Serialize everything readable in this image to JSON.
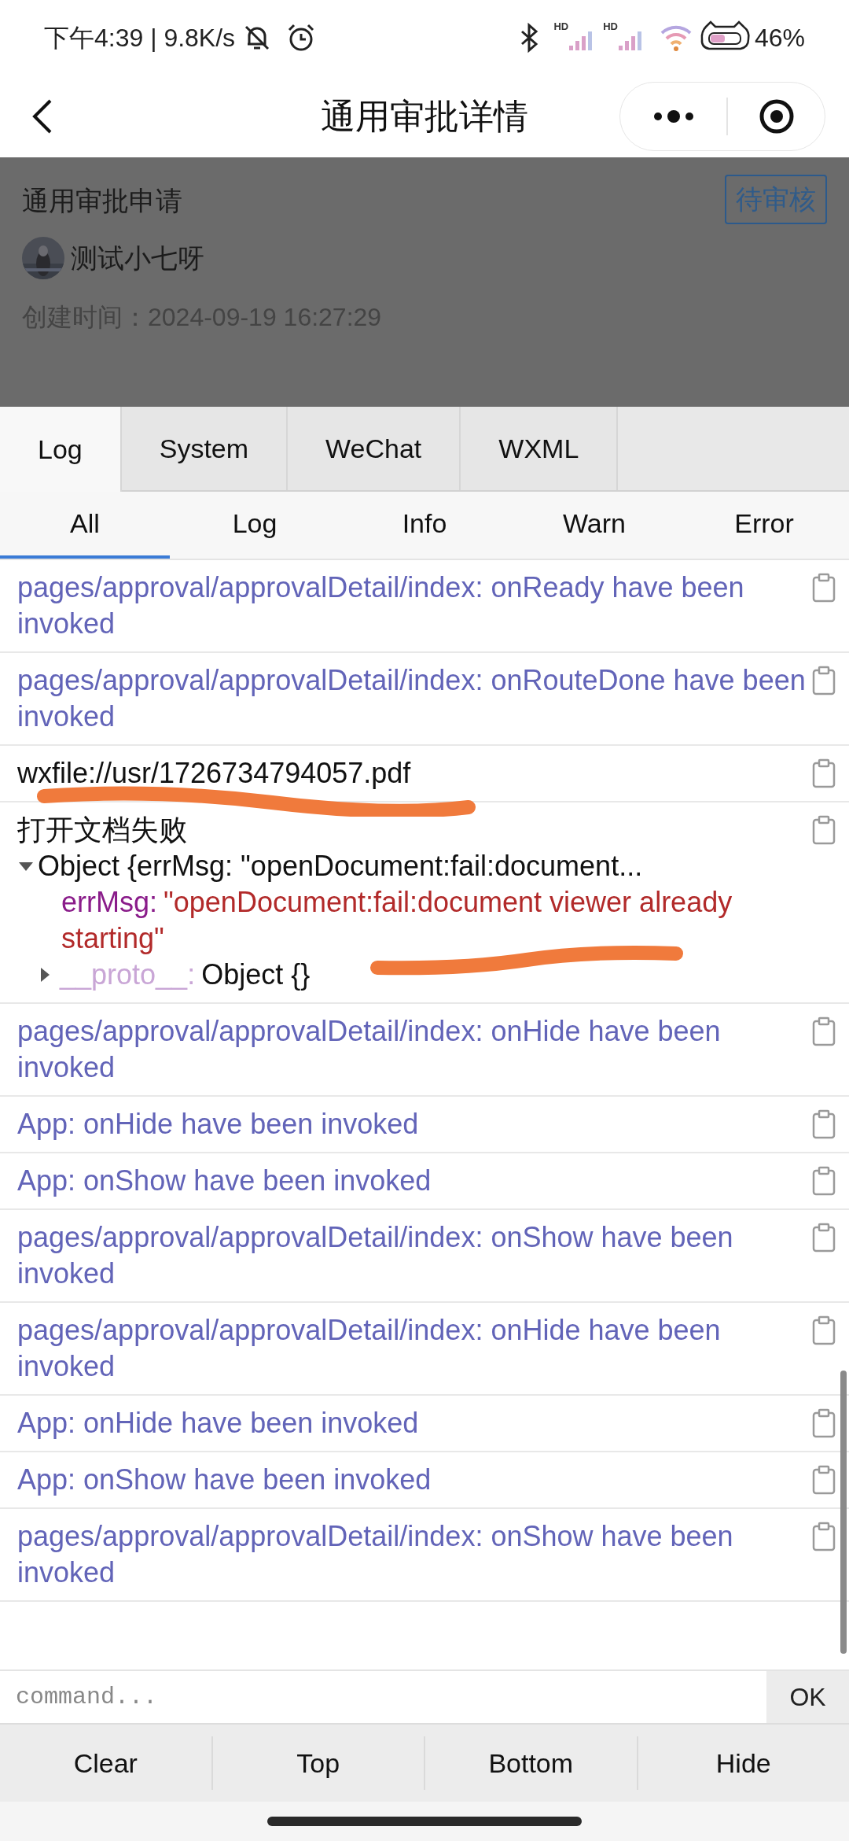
{
  "status_bar": {
    "time": "下午4:39 | 9.8K/s",
    "signals": [
      "HD",
      "HD"
    ],
    "battery": "46%"
  },
  "nav": {
    "title": "通用审批详情"
  },
  "approval": {
    "title": "通用审批申请",
    "status": "待审核",
    "applicant": "测试小七呀",
    "created": "创建时间：2024-09-19 16:27:29"
  },
  "tabs": [
    {
      "label": "Log",
      "selected": true
    },
    {
      "label": "System",
      "selected": false
    },
    {
      "label": "WeChat",
      "selected": false
    },
    {
      "label": "WXML",
      "selected": false
    }
  ],
  "filters": [
    {
      "label": "All",
      "selected": true
    },
    {
      "label": "Log",
      "selected": false
    },
    {
      "label": "Info",
      "selected": false
    },
    {
      "label": "Warn",
      "selected": false
    },
    {
      "label": "Error",
      "selected": false
    }
  ],
  "logs": [
    {
      "kind": "lifecycle",
      "text": "pages/approval/approvalDetail/index: onReady have been invoked"
    },
    {
      "kind": "lifecycle",
      "text": "pages/approval/approvalDetail/index: onRouteDone have been invoked"
    },
    {
      "kind": "plain",
      "text": "wxfile://usr/1726734794057.pdf"
    },
    {
      "kind": "object",
      "text": "打开文档失败",
      "summary": "Object {errMsg: \"openDocument:fail:document...",
      "expanded": true,
      "properties": [
        {
          "key": "errMsg:",
          "value": "\"openDocument:fail:document viewer already starting\""
        }
      ],
      "proto": {
        "key": "__proto__:",
        "value": "Object {}",
        "expanded": false
      }
    },
    {
      "kind": "lifecycle",
      "text": "pages/approval/approvalDetail/index: onHide have been invoked"
    },
    {
      "kind": "lifecycle",
      "text": "App: onHide have been invoked"
    },
    {
      "kind": "lifecycle",
      "text": "App: onShow have been invoked"
    },
    {
      "kind": "lifecycle",
      "text": "pages/approval/approvalDetail/index: onShow have been invoked"
    },
    {
      "kind": "lifecycle",
      "text": "pages/approval/approvalDetail/index: onHide have been invoked"
    },
    {
      "kind": "lifecycle",
      "text": "App: onHide have been invoked"
    },
    {
      "kind": "lifecycle",
      "text": "App: onShow have been invoked"
    },
    {
      "kind": "lifecycle",
      "text": "pages/approval/approvalDetail/index: onShow have been invoked"
    }
  ],
  "command": {
    "placeholder": "command...",
    "button": "OK"
  },
  "toolbar": [
    "Clear",
    "Top",
    "Bottom",
    "Hide"
  ]
}
